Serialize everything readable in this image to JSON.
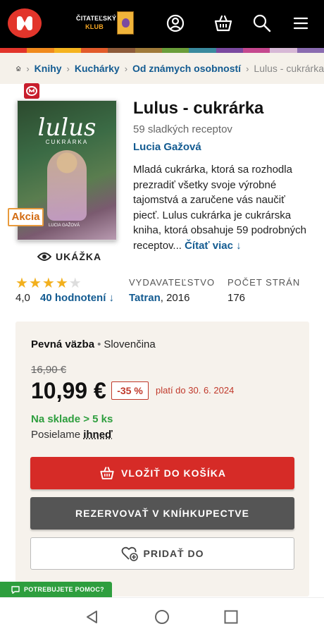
{
  "header": {
    "club_line1": "ČITATEĽSKÝ",
    "club_line2": "KLUB",
    "icons": [
      "logo-icon",
      "user-icon",
      "basket-icon",
      "search-icon",
      "menu-icon"
    ],
    "stripe_colors": [
      "#e2352b",
      "#f08a1d",
      "#f5b31f",
      "#e25b2a",
      "#8d5b3a",
      "#a07a3a",
      "#6a9e3a",
      "#3a8a9e",
      "#7b4aa0",
      "#c5488f",
      "#d7b8d6",
      "#8a6bb0"
    ]
  },
  "breadcrumb": {
    "items": [
      "Knihy",
      "Kuchárky",
      "Od známych osobností"
    ],
    "current": "Lulus - cukrárka"
  },
  "book": {
    "cover_title": "lulus",
    "cover_subtitle": "CUKRÁRKA",
    "cover_author": "LUCIA GAŽOVÁ",
    "sale_badge": "Akcia",
    "preview_label": "UKÁŽKA",
    "title": "Lulus - cukrárka",
    "subtitle": "59 sladkých receptov",
    "author": "Lucia Gažová",
    "description": "Mladá cukrárka, ktorá sa rozhodla prezradiť všetky svoje výrobné tajomstvá a zaručene vás naučiť piecť. Lulus cukrárka je cukrárska kniha, ktorá obsahuje 59 podrobných receptov... ",
    "read_more": "Čítať viac ↓"
  },
  "rating": {
    "value": "4,0",
    "stars_filled": 4,
    "stars_total": 5,
    "count_label": "40 hodnotení ↓"
  },
  "meta": {
    "publisher_heading": "VYDAVATEĽSTVO",
    "publisher": "Tatran",
    "year": ", 2016",
    "pages_heading": "POČET STRÁN",
    "pages": "176"
  },
  "buy": {
    "binding": "Pevná väzba",
    "language": "Slovenčina",
    "old_price": "16,90 €",
    "price": "10,99 €",
    "discount": "-35 %",
    "valid_until": "platí do 30. 6. 2024",
    "stock": "Na sklade > 5 ks",
    "ship_prefix": "Posielame ",
    "ship_when": "ihneď",
    "cart_button": "VLOŽIŤ DO KOŠÍKA",
    "reserve_button": "REZERVOVAŤ V KNÍHKUPECTVE",
    "add_button": "PRIDAŤ DO"
  },
  "help": {
    "label": "POTREBUJETE POMOC?"
  },
  "colors": {
    "brand_red": "#d62b27",
    "link_blue": "#135b91",
    "stock_green": "#2e9e3e",
    "star_gold": "#f2b01e"
  }
}
